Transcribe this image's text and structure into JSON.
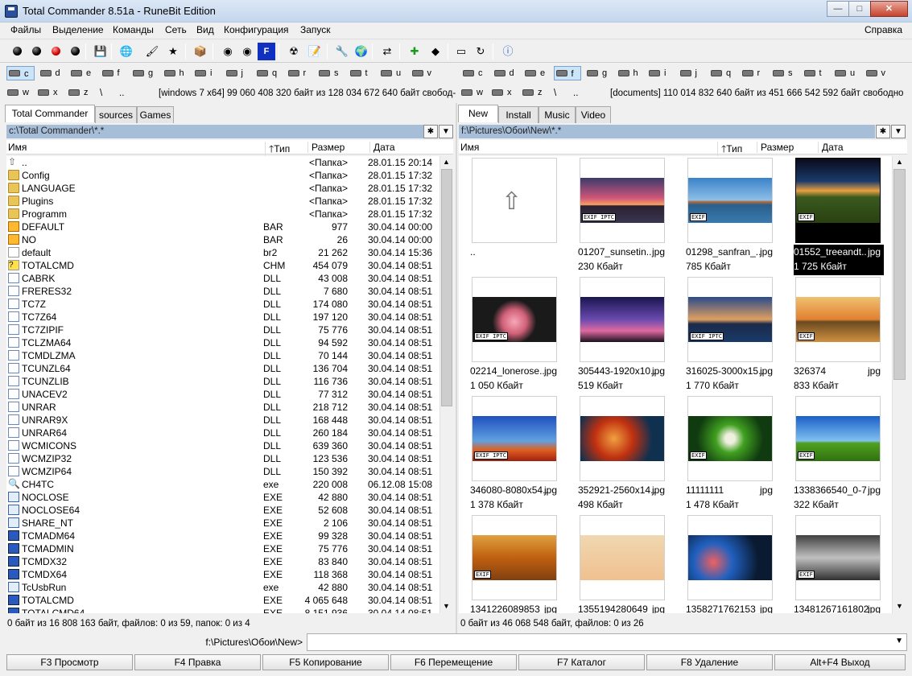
{
  "window": {
    "title": "Total Commander 8.51a - RuneBit Edition",
    "minimize": "—",
    "maximize": "□",
    "close": "✕"
  },
  "menu": {
    "items": [
      "Файлы",
      "Выделение",
      "Команды",
      "Сеть",
      "Вид",
      "Конфигурация",
      "Запуск"
    ],
    "help": "Справка"
  },
  "toolbar": {
    "icons": [
      "black-ball-icon",
      "black-ball-icon",
      "red-ball-icon",
      "black-ball-icon",
      "disk-icon",
      "network-icon",
      "brush-icon",
      "star-icon",
      "package-icon",
      "cd-icon",
      "cd-icon",
      "f2i-icon",
      "cd-burn-icon",
      "notepad-icon",
      "wrench-icon",
      "globe-icon",
      "compare-icon",
      "plus-icon",
      "tag-icon",
      "drive-icon",
      "sync-icon",
      "info-icon"
    ]
  },
  "left": {
    "drives_row1": [
      "c",
      "d",
      "e",
      "f",
      "g",
      "h",
      "i",
      "j",
      "q",
      "r",
      "s",
      "t",
      "u",
      "v"
    ],
    "drives_row2": [
      "w",
      "x",
      "z"
    ],
    "selected_drive": "c",
    "drive_info": "[windows 7 x64]  99 060 408 320 байт из 128 034 672 640 байт свобод-",
    "tabs": [
      "Total Commander",
      "sources",
      "Games"
    ],
    "path": "c:\\Total Commander\\*.*",
    "columns": {
      "name": "Имя",
      "type": "Тип",
      "size": "Размер",
      "date": "Дата"
    },
    "files": [
      {
        "name": "..",
        "type": "",
        "size": "<Папка>",
        "date": "28.01.15 20:14",
        "kind": "up"
      },
      {
        "name": "Config",
        "type": "",
        "size": "<Папка>",
        "date": "28.01.15 17:32",
        "kind": "folder"
      },
      {
        "name": "LANGUAGE",
        "type": "",
        "size": "<Папка>",
        "date": "28.01.15 17:32",
        "kind": "folder"
      },
      {
        "name": "Plugins",
        "type": "",
        "size": "<Папка>",
        "date": "28.01.15 17:32",
        "kind": "folder"
      },
      {
        "name": "Programm",
        "type": "",
        "size": "<Папка>",
        "date": "28.01.15 17:32",
        "kind": "folder"
      },
      {
        "name": "DEFAULT",
        "type": "BAR",
        "size": "977",
        "date": "30.04.14 00:00",
        "kind": "bar"
      },
      {
        "name": "NO",
        "type": "BAR",
        "size": "26",
        "date": "30.04.14 00:00",
        "kind": "bar"
      },
      {
        "name": "default",
        "type": "br2",
        "size": "21 262",
        "date": "30.04.14 15:36",
        "kind": "misc"
      },
      {
        "name": "TOTALCMD",
        "type": "CHM",
        "size": "454 079",
        "date": "30.04.14 08:51",
        "kind": "chm"
      },
      {
        "name": "CABRK",
        "type": "DLL",
        "size": "43 008",
        "date": "30.04.14 08:51",
        "kind": "dll"
      },
      {
        "name": "FRERES32",
        "type": "DLL",
        "size": "7 680",
        "date": "30.04.14 08:51",
        "kind": "dll"
      },
      {
        "name": "TC7Z",
        "type": "DLL",
        "size": "174 080",
        "date": "30.04.14 08:51",
        "kind": "dll"
      },
      {
        "name": "TC7Z64",
        "type": "DLL",
        "size": "197 120",
        "date": "30.04.14 08:51",
        "kind": "dll"
      },
      {
        "name": "TC7ZIPIF",
        "type": "DLL",
        "size": "75 776",
        "date": "30.04.14 08:51",
        "kind": "dll"
      },
      {
        "name": "TCLZMA64",
        "type": "DLL",
        "size": "94 592",
        "date": "30.04.14 08:51",
        "kind": "dll"
      },
      {
        "name": "TCMDLZMA",
        "type": "DLL",
        "size": "70 144",
        "date": "30.04.14 08:51",
        "kind": "dll"
      },
      {
        "name": "TCUNZL64",
        "type": "DLL",
        "size": "136 704",
        "date": "30.04.14 08:51",
        "kind": "dll"
      },
      {
        "name": "TCUNZLIB",
        "type": "DLL",
        "size": "116 736",
        "date": "30.04.14 08:51",
        "kind": "dll"
      },
      {
        "name": "UNACEV2",
        "type": "DLL",
        "size": "77 312",
        "date": "30.04.14 08:51",
        "kind": "dll"
      },
      {
        "name": "UNRAR",
        "type": "DLL",
        "size": "218 712",
        "date": "30.04.14 08:51",
        "kind": "dll"
      },
      {
        "name": "UNRAR9X",
        "type": "DLL",
        "size": "168 448",
        "date": "30.04.14 08:51",
        "kind": "dll"
      },
      {
        "name": "UNRAR64",
        "type": "DLL",
        "size": "260 184",
        "date": "30.04.14 08:51",
        "kind": "dll"
      },
      {
        "name": "WCMICONS",
        "type": "DLL",
        "size": "639 360",
        "date": "30.04.14 08:51",
        "kind": "dll"
      },
      {
        "name": "WCMZIP32",
        "type": "DLL",
        "size": "123 536",
        "date": "30.04.14 08:51",
        "kind": "dll"
      },
      {
        "name": "WCMZIP64",
        "type": "DLL",
        "size": "150 392",
        "date": "30.04.14 08:51",
        "kind": "dll"
      },
      {
        "name": "CH4TC",
        "type": "exe",
        "size": "220 008",
        "date": "06.12.08 15:08",
        "kind": "search"
      },
      {
        "name": "NOCLOSE",
        "type": "EXE",
        "size": "42 880",
        "date": "30.04.14 08:51",
        "kind": "exe"
      },
      {
        "name": "NOCLOSE64",
        "type": "EXE",
        "size": "52 608",
        "date": "30.04.14 08:51",
        "kind": "exe"
      },
      {
        "name": "SHARE_NT",
        "type": "EXE",
        "size": "2 106",
        "date": "30.04.14 08:51",
        "kind": "exe"
      },
      {
        "name": "TCMADM64",
        "type": "EXE",
        "size": "99 328",
        "date": "30.04.14 08:51",
        "kind": "warn"
      },
      {
        "name": "TCMADMIN",
        "type": "EXE",
        "size": "75 776",
        "date": "30.04.14 08:51",
        "kind": "warn"
      },
      {
        "name": "TCMDX32",
        "type": "EXE",
        "size": "83 840",
        "date": "30.04.14 08:51",
        "kind": "warn"
      },
      {
        "name": "TCMDX64",
        "type": "EXE",
        "size": "118 368",
        "date": "30.04.14 08:51",
        "kind": "warn"
      },
      {
        "name": "TcUsbRun",
        "type": "exe",
        "size": "42 880",
        "date": "30.04.14 08:51",
        "kind": "exe"
      },
      {
        "name": "TOTALCMD",
        "type": "EXE",
        "size": "4 065 648",
        "date": "30.04.14 08:51",
        "kind": "warn"
      },
      {
        "name": "TOTALCMD64",
        "type": "EXE",
        "size": "8 151 936",
        "date": "30.04.14 08:51",
        "kind": "warn"
      }
    ],
    "status": "0 байт из 16 808 163 байт, файлов: 0 из 59, папок: 0 из 4"
  },
  "right": {
    "drives_row1": [
      "c",
      "d",
      "e",
      "f",
      "g",
      "h",
      "i",
      "j",
      "q",
      "r",
      "s",
      "t",
      "u",
      "v"
    ],
    "drives_row2": [
      "w",
      "x",
      "z"
    ],
    "selected_drive": "f",
    "drive_info": "[documents]  110 014 832 640 байт из 451 666 542 592 байт свободно",
    "tabs": [
      "New",
      "Install",
      "Music",
      "Video"
    ],
    "path": "f:\\Pictures\\Обои\\New\\*.*",
    "columns": {
      "name": "Имя",
      "type": "Тип",
      "size": "Размер",
      "date": "Дата"
    },
    "thumbs": [
      {
        "name": "..",
        "ext": "",
        "size": "",
        "kind": "up",
        "badge": ""
      },
      {
        "name": "01207_sunsetin..",
        "ext": "jpg",
        "size": "230 Кбайт",
        "kind": "sunset",
        "badge": "EXIF IPTC"
      },
      {
        "name": "01298_sanfran_..",
        "ext": "jpg",
        "size": "785 Кбайт",
        "kind": "bridge",
        "badge": "EXIF"
      },
      {
        "name": "01552_treeandt..",
        "ext": "jpg",
        "size": "1 725 Кбайт",
        "kind": "tree",
        "badge": "EXIF",
        "selected": true
      },
      {
        "name": "02214_lonerose..",
        "ext": "jpg",
        "size": "1 050 Кбайт",
        "kind": "rose",
        "badge": "EXIF IPTC"
      },
      {
        "name": "305443-1920x10..",
        "ext": "jpg",
        "size": "519 Кбайт",
        "kind": "dusk",
        "badge": ""
      },
      {
        "name": "316025-3000x15..",
        "ext": "jpg",
        "size": "1 770 Кбайт",
        "kind": "city",
        "badge": "EXIF IPTC"
      },
      {
        "name": "326374",
        "ext": "jpg",
        "size": "833 Кбайт",
        "kind": "lake",
        "badge": "EXIF"
      },
      {
        "name": "346080-8080x54..",
        "ext": "jpg",
        "size": "1 378 Кбайт",
        "kind": "paris",
        "badge": "EXIF IPTC"
      },
      {
        "name": "352921-2560x14..",
        "ext": "jpg",
        "size": "498 Кбайт",
        "kind": "nebula",
        "badge": ""
      },
      {
        "name": "11111111",
        "ext": "jpg",
        "size": "1 478 Кбайт",
        "kind": "green",
        "badge": "EXIF"
      },
      {
        "name": "1338366540_0-7",
        "ext": "jpg",
        "size": "322 Кбайт",
        "kind": "meadow",
        "badge": "EXIF"
      },
      {
        "name": "1341226089853",
        "ext": "jpg",
        "size": "",
        "kind": "autumn",
        "badge": "EXIF"
      },
      {
        "name": "1355194280649",
        "ext": "jpg",
        "size": "",
        "kind": "art",
        "badge": ""
      },
      {
        "name": "1358271762153",
        "ext": "jpg",
        "size": "",
        "kind": "bokeh",
        "badge": ""
      },
      {
        "name": "13481267161802",
        "ext": "jpg",
        "size": "",
        "kind": "gray",
        "badge": "EXIF"
      }
    ],
    "status": "0 байт из 46 068 548 байт, файлов: 0 из 26"
  },
  "cmdline": {
    "label": "f:\\Pictures\\Обои\\New>",
    "value": ""
  },
  "fkeys": [
    "F3 Просмотр",
    "F4 Правка",
    "F5 Копирование",
    "F6 Перемещение",
    "F7 Каталог",
    "F8 Удаление",
    "Alt+F4 Выход"
  ],
  "colors": {
    "path_active": "#a7bed8",
    "selection": "#000000",
    "drive_selected": "#cce4f7"
  }
}
